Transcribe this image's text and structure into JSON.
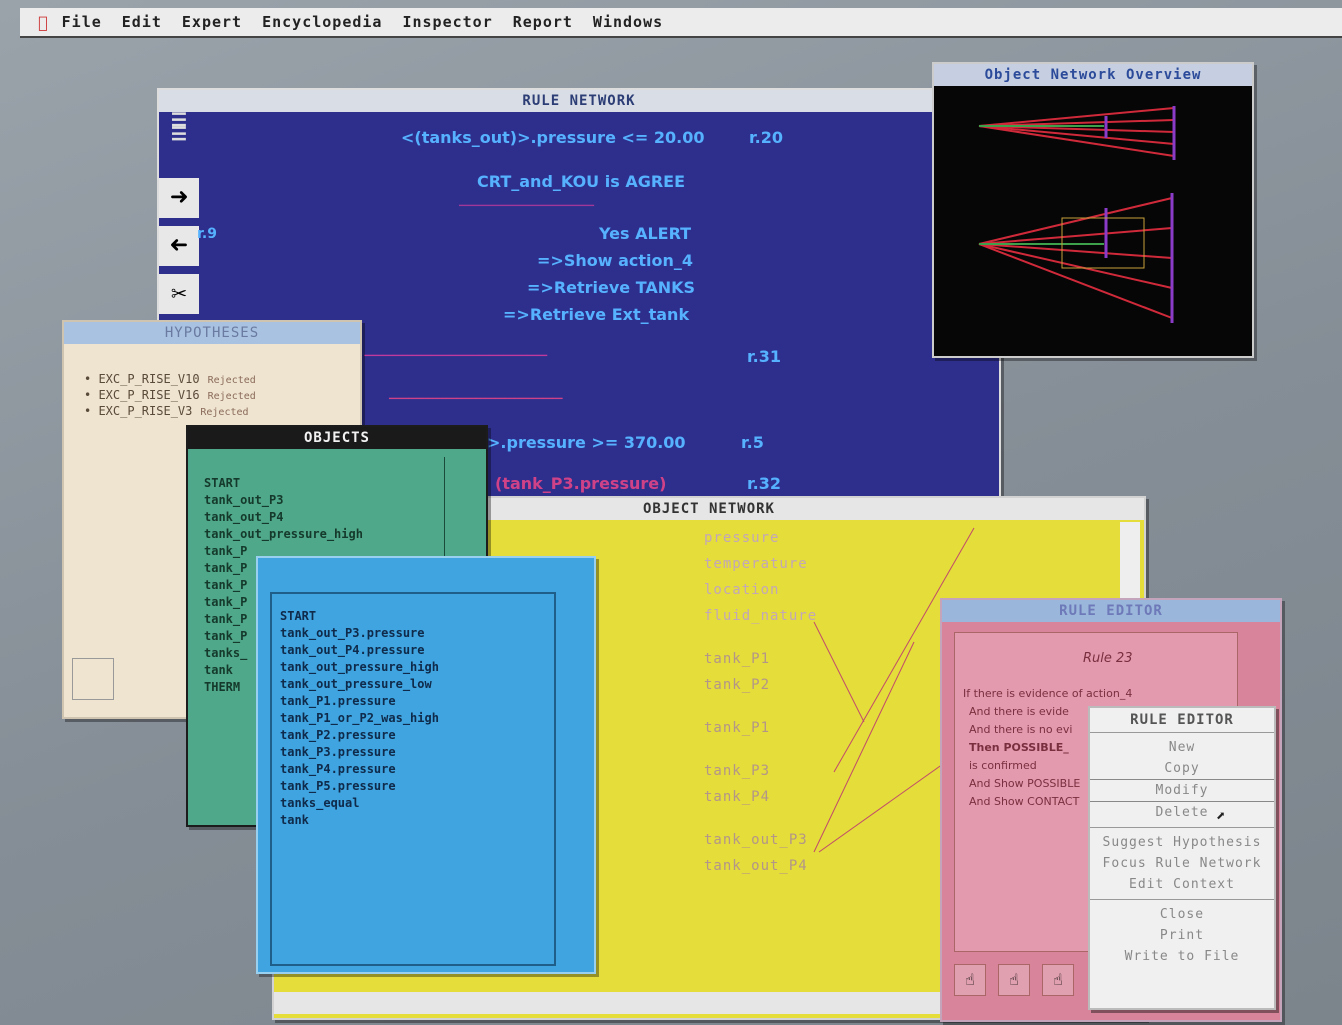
{
  "menubar": {
    "apple": "",
    "items": [
      "File",
      "Edit",
      "Expert",
      "Encyclopedia",
      "Inspector",
      "Report",
      "Windows"
    ]
  },
  "rule_network": {
    "title": "RULE NETWORK",
    "rule_ids": [
      "r.20",
      "r.9",
      "r.31",
      "r.5",
      "r.32"
    ],
    "lines": [
      "<(tanks_out)>.pressure <= 20.00",
      "CRT_and_KOU is AGREE",
      "Yes ALERT",
      "=>Show action_4",
      "=>Retrieve TANKS",
      "=>Retrieve Ext_tank",
      ">.pressure >= 370.00",
      "(tank_P3.pressure)"
    ]
  },
  "overview": {
    "title": "Object Network Overview"
  },
  "hypotheses": {
    "title": "HYPOTHESES",
    "items": [
      {
        "name": "EXC_P_RISE_V10",
        "status": "Rejected"
      },
      {
        "name": "EXC_P_RISE_V16",
        "status": "Rejected"
      },
      {
        "name": "EXC_P_RISE_V3",
        "status": "Rejected"
      }
    ]
  },
  "objects": {
    "title": "OBJECTS",
    "items": [
      "START",
      "tank_out_P3",
      "tank_out_P4",
      "tank_out_pressure_high",
      "tank_P",
      "tank_P",
      "tank_P",
      "tank_P",
      "tank_P",
      "tank_P",
      "tanks_",
      "tank",
      "THERM"
    ]
  },
  "blue_list": {
    "items": [
      "START",
      "tank_out_P3.pressure",
      "tank_out_P4.pressure",
      "tank_out_pressure_high",
      "tank_out_pressure_low",
      "tank_P1.pressure",
      "tank_P1_or_P2_was_high",
      "tank_P2.pressure",
      "tank_P3.pressure",
      "tank_P4.pressure",
      "tank_P5.pressure",
      "tanks_equal",
      "tank"
    ]
  },
  "object_network": {
    "title": "OBJECT NETWORK",
    "properties": [
      "pressure",
      "temperature",
      "location",
      "fluid_nature"
    ],
    "nodes": [
      "tank_P1",
      "tank_P2",
      "tank_P1",
      "tank_P3",
      "tank_P4",
      "tank_out_P3",
      "tank_out_P4"
    ]
  },
  "rule_editor_window": {
    "title": "RULE EDITOR",
    "rule_name": "Rule 23",
    "lines": [
      "If  there is evidence of action_4",
      "And there is evide",
      "And there is no evi",
      "Then POSSIBLE_",
      "is confirmed",
      "And Show POSSIBLE",
      "And Show CONTACT"
    ]
  },
  "popup_menu": {
    "title": "RULE EDITOR",
    "group1": [
      "New",
      "Copy",
      "Modify",
      "Delete"
    ],
    "group2": [
      "Suggest Hypothesis",
      "Focus Rule Network",
      "Edit Context"
    ],
    "group3": [
      "Close",
      "Print",
      "Write to File"
    ]
  },
  "colors": {
    "rule_network_bg": "#2e2f8c",
    "object_network_bg": "#e4dd3a",
    "objects_bg": "#4fa88a",
    "blue_list_bg": "#3fa4df",
    "rule_editor_bg": "#d8859b"
  }
}
